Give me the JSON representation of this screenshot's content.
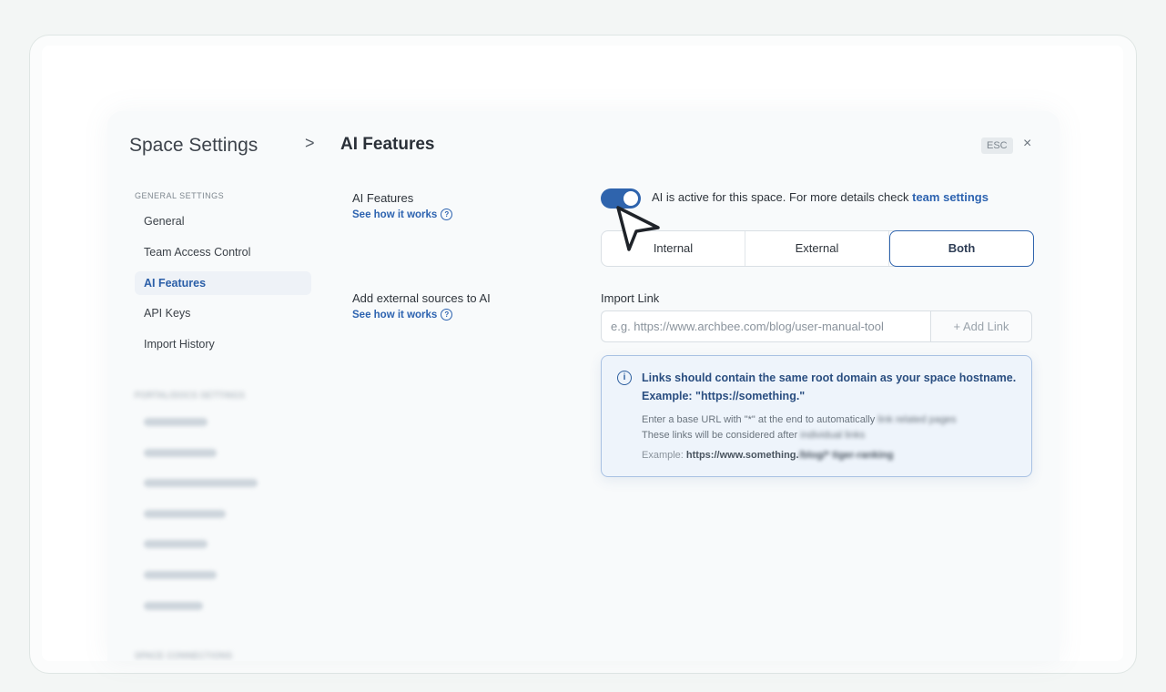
{
  "header": {
    "breadcrumb_root": "Space Settings",
    "breadcrumb_separator": ">",
    "page_title": "AI Features",
    "esc_label": "ESC",
    "close_icon": "×"
  },
  "sidebar": {
    "general_heading": "GENERAL SETTINGS",
    "items": [
      {
        "label": "General"
      },
      {
        "label": "Team Access Control"
      },
      {
        "label": "AI Features"
      },
      {
        "label": "API Keys"
      },
      {
        "label": "Import History"
      }
    ],
    "docs_heading": "PORTAL/DOCS SETTINGS",
    "connections_heading": "SPACE CONNECTIONS"
  },
  "main": {
    "ai_features": {
      "label": "AI Features",
      "link": "See how it works",
      "toggle_on": true,
      "toggle_text": "AI is active for this space. For more details check",
      "toggle_link": "team settings",
      "segments": [
        "Internal",
        "External",
        "Both"
      ],
      "selected_segment": "Both"
    },
    "external_sources": {
      "label": "Add external sources to AI",
      "link": "See how it works",
      "import_label": "Import Link",
      "import_placeholder": "e.g. https://www.archbee.com/blog/user-manual-tool",
      "add_link_label": "+  Add Link"
    },
    "info": {
      "title": "Links should contain the same root domain as your space hostname. Example: \"https://something.\"",
      "line1": "Enter a base URL with \"*\" at the end to automatically",
      "line1_blurred": "link related pages",
      "line2": "These links will be considered after",
      "line2_blurred": "individual links",
      "example_label": "Example:",
      "example_value": "https://www.something.",
      "example_blurred": "/blog/* tiger-ranking"
    }
  },
  "colors": {
    "accent": "#2f64ad",
    "link": "#2d63b0",
    "info_bg": "#eef4fb"
  }
}
